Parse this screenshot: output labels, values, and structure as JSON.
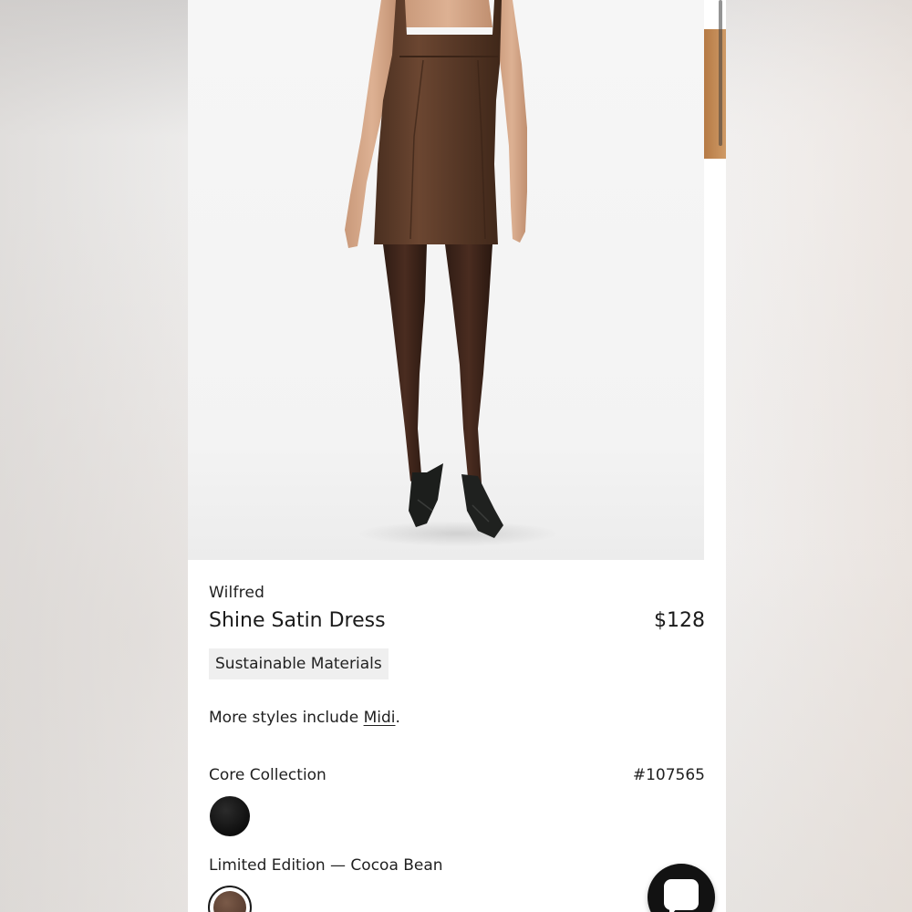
{
  "product": {
    "brand": "Wilfred",
    "name": "Shine Satin Dress",
    "price": "$128",
    "badge": "Sustainable Materials",
    "styles_prefix": "More styles include ",
    "styles_link": "Midi",
    "styles_suffix": ".",
    "collection": "Core Collection",
    "sku": "#107565",
    "limited_edition": "Limited Edition — Cocoa Bean"
  },
  "swatches": [
    {
      "name": "black",
      "color": "#151515"
    },
    {
      "name": "cocoa-bean",
      "color": "#6a4a3b",
      "selected": true
    }
  ],
  "colors": {
    "badge_bg": "#efefef",
    "chat_button": "#121212",
    "dress": "#5a3a28"
  },
  "icons": {
    "chat": "chat-bubble-icon"
  }
}
